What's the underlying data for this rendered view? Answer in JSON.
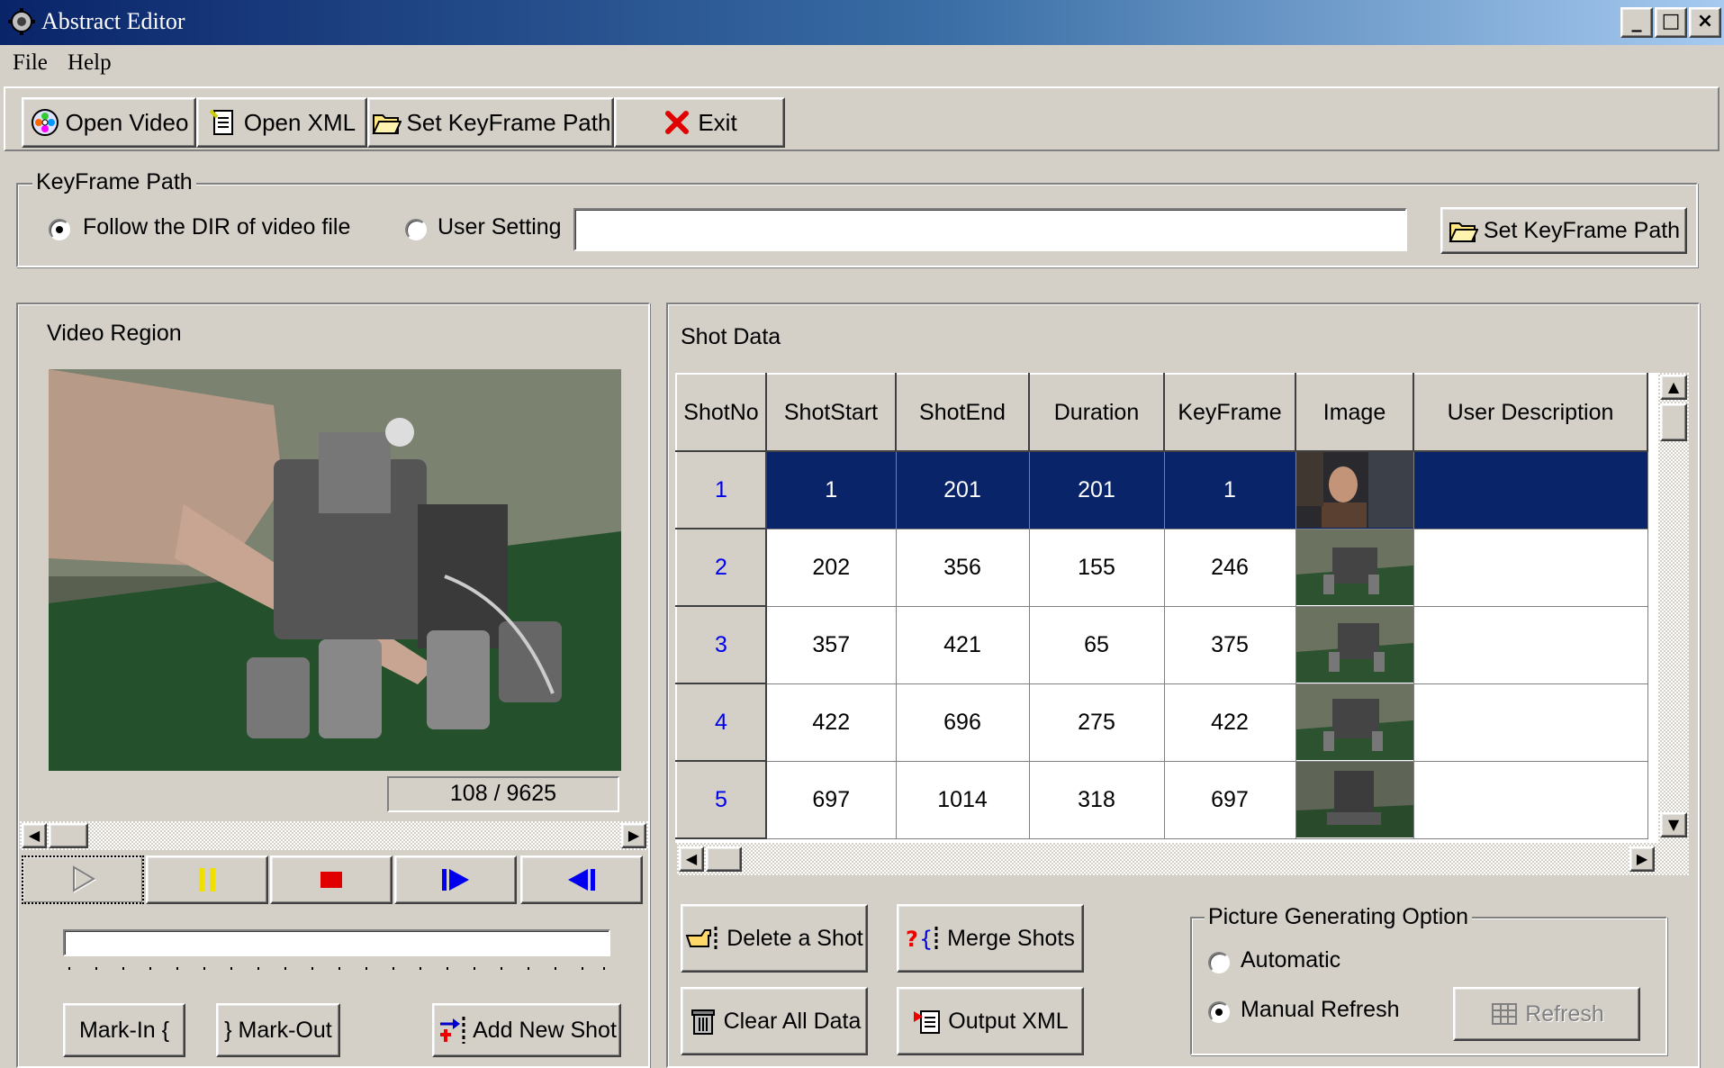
{
  "window": {
    "title": "Abstract Editor",
    "minimize": "_",
    "maximize": "□",
    "close": "×"
  },
  "menu": {
    "file": "File",
    "help": "Help"
  },
  "toolbar": {
    "open_video": "Open Video",
    "open_xml": "Open XML",
    "set_keyframe_path": "Set KeyFrame Path",
    "exit": "Exit"
  },
  "keyframe_path": {
    "legend": "KeyFrame Path",
    "option_follow": "Follow the DIR of video file",
    "option_user": "User Setting",
    "selected": "follow",
    "path_value": "",
    "set_button": "Set KeyFrame Path"
  },
  "video_region": {
    "label": "Video Region",
    "frame_counter": "108 / 9625",
    "progress": 0.0112,
    "mark_in": "Mark-In {",
    "mark_out": "} Mark-Out",
    "add_new_shot": "Add New Shot"
  },
  "shot_data": {
    "label": "Shot Data",
    "columns": [
      "ShotNo",
      "ShotStart",
      "ShotEnd",
      "Duration",
      "KeyFrame",
      "Image",
      "User Description"
    ],
    "rows": [
      {
        "no": "1",
        "start": "1",
        "end": "201",
        "duration": "201",
        "keyframe": "1",
        "desc": ""
      },
      {
        "no": "2",
        "start": "202",
        "end": "356",
        "duration": "155",
        "keyframe": "246",
        "desc": ""
      },
      {
        "no": "3",
        "start": "357",
        "end": "421",
        "duration": "65",
        "keyframe": "375",
        "desc": ""
      },
      {
        "no": "4",
        "start": "422",
        "end": "696",
        "duration": "275",
        "keyframe": "422",
        "desc": ""
      },
      {
        "no": "5",
        "start": "697",
        "end": "1014",
        "duration": "318",
        "keyframe": "697",
        "desc": ""
      }
    ],
    "selected_row": "1",
    "delete_shot": "Delete a Shot",
    "merge_shots": "Merge Shots",
    "clear_all": "Clear All Data",
    "output_xml": "Output XML"
  },
  "picture_option": {
    "legend": "Picture Generating Option",
    "automatic": "Automatic",
    "manual": "Manual Refresh",
    "selected": "manual",
    "refresh": "Refresh"
  },
  "colors": {
    "selection": "#0a246a",
    "face": "#d4d0c8",
    "row_number": "#0000ee"
  }
}
